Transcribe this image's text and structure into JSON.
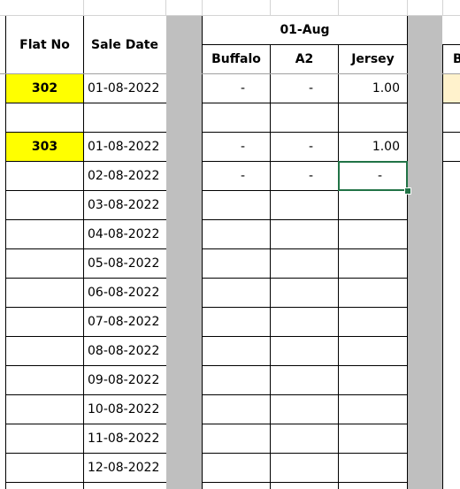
{
  "sheet": {
    "headers": {
      "flat_no": "Flat No",
      "sale_date": "Sale Date",
      "date_group": "01-Aug",
      "sub_columns": [
        "Buffalo",
        "A2",
        "Jersey"
      ],
      "next_group_partial": "B"
    },
    "rows": [
      {
        "flat": "302",
        "date": "01-08-2022",
        "buffalo": "-",
        "a2": "-",
        "jersey": "1.00"
      },
      {
        "flat": "",
        "date": "",
        "buffalo": "",
        "a2": "",
        "jersey": ""
      },
      {
        "flat": "303",
        "date": "01-08-2022",
        "buffalo": "-",
        "a2": "-",
        "jersey": "1.00"
      },
      {
        "flat": "",
        "date": "02-08-2022",
        "buffalo": "-",
        "a2": "-",
        "jersey": "-"
      },
      {
        "flat": "",
        "date": "03-08-2022",
        "buffalo": "",
        "a2": "",
        "jersey": ""
      },
      {
        "flat": "",
        "date": "04-08-2022",
        "buffalo": "",
        "a2": "",
        "jersey": ""
      },
      {
        "flat": "",
        "date": "05-08-2022",
        "buffalo": "",
        "a2": "",
        "jersey": ""
      },
      {
        "flat": "",
        "date": "06-08-2022",
        "buffalo": "",
        "a2": "",
        "jersey": ""
      },
      {
        "flat": "",
        "date": "07-08-2022",
        "buffalo": "",
        "a2": "",
        "jersey": ""
      },
      {
        "flat": "",
        "date": "08-08-2022",
        "buffalo": "",
        "a2": "",
        "jersey": ""
      },
      {
        "flat": "",
        "date": "09-08-2022",
        "buffalo": "",
        "a2": "",
        "jersey": ""
      },
      {
        "flat": "",
        "date": "10-08-2022",
        "buffalo": "",
        "a2": "",
        "jersey": ""
      },
      {
        "flat": "",
        "date": "11-08-2022",
        "buffalo": "",
        "a2": "",
        "jersey": ""
      },
      {
        "flat": "",
        "date": "12-08-2022",
        "buffalo": "",
        "a2": "",
        "jersey": ""
      }
    ],
    "selected_cell": {
      "row": 4,
      "column": "Jersey"
    },
    "colors": {
      "flat_highlight": "#ffff00",
      "separator_gray": "#bfbfbf",
      "selection": "#217346",
      "peach_fill": "#fff2cc"
    }
  }
}
